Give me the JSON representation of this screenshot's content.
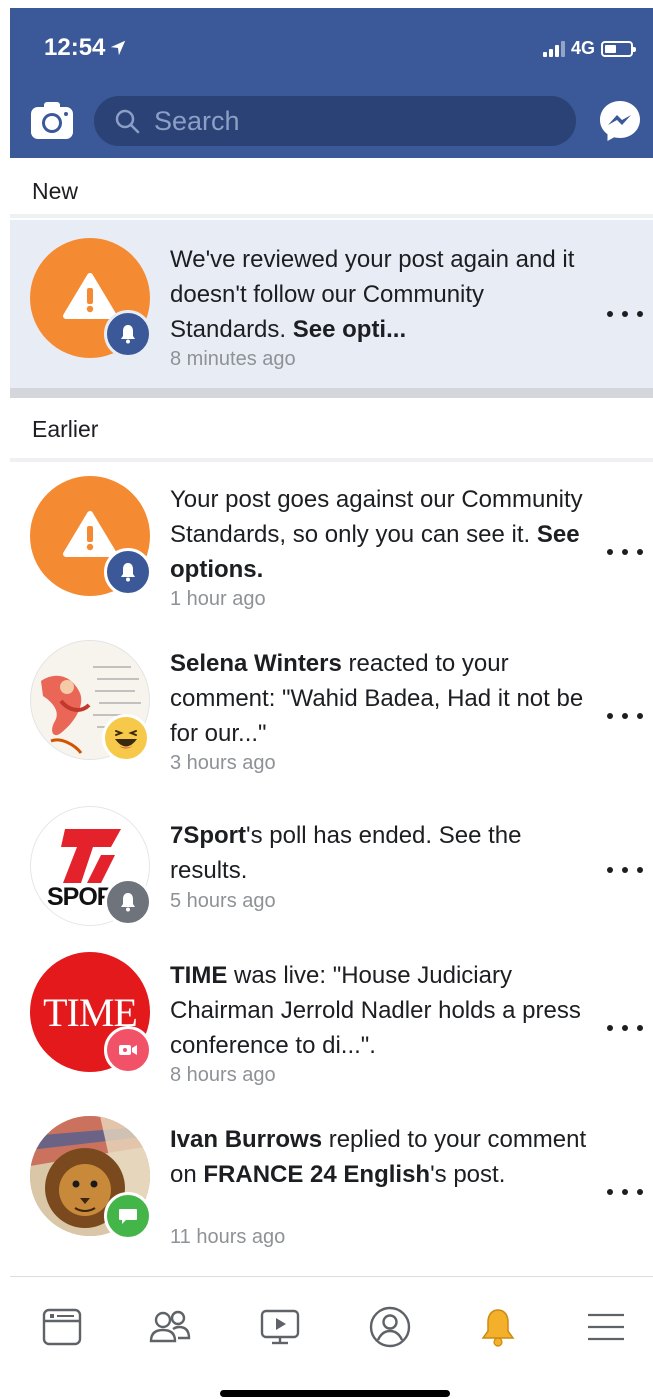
{
  "status": {
    "time": "12:54",
    "network": "4G",
    "battery_level": 0.45
  },
  "search": {
    "placeholder": "Search"
  },
  "icons": {
    "camera": "camera-icon",
    "search": "search-icon",
    "messenger": "messenger-icon",
    "more": "more-horizontal-icon"
  },
  "colors": {
    "header": "#3b5998",
    "unread_bg": "#e8edf5",
    "warning_orange": "#f48b33",
    "bell_blue": "#3b5998",
    "active_tab": "#f5b02b"
  },
  "sections": {
    "new": "New",
    "earlier": "Earlier"
  },
  "notifications": [
    {
      "text_before": "We've reviewed your post again and it doesn't follow our Community Standards. ",
      "bold": "See opti...",
      "time": "8 minutes ago",
      "unread": true,
      "avatar": "warning-icon",
      "badge": "bell-icon"
    },
    {
      "text_before": "Your post goes against our Community Standards, so only you can see it. ",
      "bold": "See options.",
      "time": "1 hour ago",
      "unread": false,
      "avatar": "warning-icon",
      "badge": "bell-icon"
    },
    {
      "bold": "Selena Winters",
      "text_after": " reacted to your comment: \"Wahid Badea, Had it not be for our...\"",
      "time": "3 hours ago",
      "unread": false,
      "avatar": "user-photo",
      "badge": "haha-reaction-icon"
    },
    {
      "bold": "7Sport",
      "text_after": "'s poll has ended. See the results.",
      "time": "5 hours ago",
      "unread": false,
      "avatar": "7sport-logo",
      "avatar_text": "SPOR",
      "badge": "bell-icon"
    },
    {
      "bold": "TIME",
      "text_after": " was live: \"House Judiciary Chairman Jerrold Nadler holds a press conference to di...\".",
      "time": "8 hours ago",
      "unread": false,
      "avatar": "time-logo",
      "avatar_text": "TIME",
      "badge": "live-video-icon"
    },
    {
      "bold": "Ivan Burrows",
      "text_mid": " replied to your comment on ",
      "bold2": "FRANCE 24 English",
      "text_after": "'s post.",
      "time": "11 hours ago",
      "unread": false,
      "avatar": "user-photo",
      "badge": "comment-icon"
    }
  ],
  "tabs": [
    {
      "name": "news-feed-tab",
      "icon": "news-feed-icon",
      "active": false
    },
    {
      "name": "friends-tab",
      "icon": "friends-icon",
      "active": false
    },
    {
      "name": "watch-tab",
      "icon": "watch-icon",
      "active": false
    },
    {
      "name": "profile-tab",
      "icon": "profile-icon",
      "active": false
    },
    {
      "name": "notifications-tab",
      "icon": "bell-icon",
      "active": true
    },
    {
      "name": "menu-tab",
      "icon": "hamburger-icon",
      "active": false
    }
  ]
}
